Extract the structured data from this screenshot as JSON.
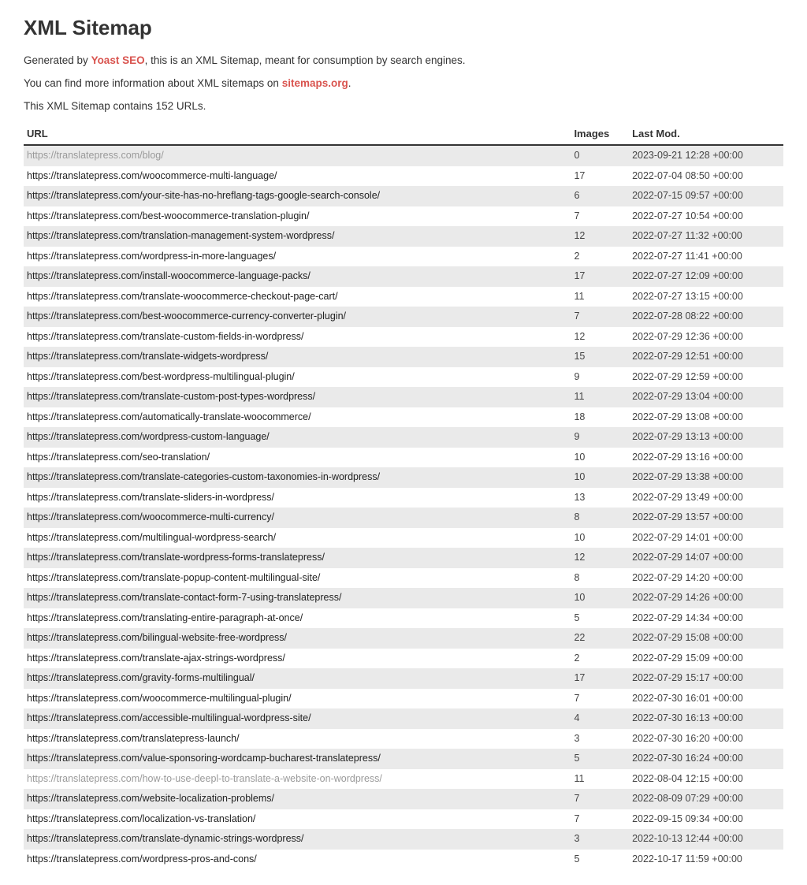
{
  "title": "XML Sitemap",
  "intro": {
    "generated_prefix": "Generated by ",
    "generated_link": "Yoast SEO",
    "generated_suffix": ", this is an XML Sitemap, meant for consumption by search engines.",
    "moreinfo_prefix": "You can find more information about XML sitemaps on ",
    "moreinfo_link": "sitemaps.org",
    "moreinfo_suffix": ".",
    "count_text": "This XML Sitemap contains 152 URLs."
  },
  "headers": {
    "url": "URL",
    "images": "Images",
    "lastmod": "Last Mod."
  },
  "rows": [
    {
      "url": "https://translatepress.com/blog/",
      "images": "0",
      "lastmod": "2023-09-21 12:28 +00:00",
      "muted": true
    },
    {
      "url": "https://translatepress.com/woocommerce-multi-language/",
      "images": "17",
      "lastmod": "2022-07-04 08:50 +00:00"
    },
    {
      "url": "https://translatepress.com/your-site-has-no-hreflang-tags-google-search-console/",
      "images": "6",
      "lastmod": "2022-07-15 09:57 +00:00"
    },
    {
      "url": "https://translatepress.com/best-woocommerce-translation-plugin/",
      "images": "7",
      "lastmod": "2022-07-27 10:54 +00:00"
    },
    {
      "url": "https://translatepress.com/translation-management-system-wordpress/",
      "images": "12",
      "lastmod": "2022-07-27 11:32 +00:00"
    },
    {
      "url": "https://translatepress.com/wordpress-in-more-languages/",
      "images": "2",
      "lastmod": "2022-07-27 11:41 +00:00"
    },
    {
      "url": "https://translatepress.com/install-woocommerce-language-packs/",
      "images": "17",
      "lastmod": "2022-07-27 12:09 +00:00"
    },
    {
      "url": "https://translatepress.com/translate-woocommerce-checkout-page-cart/",
      "images": "11",
      "lastmod": "2022-07-27 13:15 +00:00"
    },
    {
      "url": "https://translatepress.com/best-woocommerce-currency-converter-plugin/",
      "images": "7",
      "lastmod": "2022-07-28 08:22 +00:00"
    },
    {
      "url": "https://translatepress.com/translate-custom-fields-in-wordpress/",
      "images": "12",
      "lastmod": "2022-07-29 12:36 +00:00"
    },
    {
      "url": "https://translatepress.com/translate-widgets-wordpress/",
      "images": "15",
      "lastmod": "2022-07-29 12:51 +00:00"
    },
    {
      "url": "https://translatepress.com/best-wordpress-multilingual-plugin/",
      "images": "9",
      "lastmod": "2022-07-29 12:59 +00:00"
    },
    {
      "url": "https://translatepress.com/translate-custom-post-types-wordpress/",
      "images": "11",
      "lastmod": "2022-07-29 13:04 +00:00"
    },
    {
      "url": "https://translatepress.com/automatically-translate-woocommerce/",
      "images": "18",
      "lastmod": "2022-07-29 13:08 +00:00"
    },
    {
      "url": "https://translatepress.com/wordpress-custom-language/",
      "images": "9",
      "lastmod": "2022-07-29 13:13 +00:00"
    },
    {
      "url": "https://translatepress.com/seo-translation/",
      "images": "10",
      "lastmod": "2022-07-29 13:16 +00:00"
    },
    {
      "url": "https://translatepress.com/translate-categories-custom-taxonomies-in-wordpress/",
      "images": "10",
      "lastmod": "2022-07-29 13:38 +00:00"
    },
    {
      "url": "https://translatepress.com/translate-sliders-in-wordpress/",
      "images": "13",
      "lastmod": "2022-07-29 13:49 +00:00"
    },
    {
      "url": "https://translatepress.com/woocommerce-multi-currency/",
      "images": "8",
      "lastmod": "2022-07-29 13:57 +00:00"
    },
    {
      "url": "https://translatepress.com/multilingual-wordpress-search/",
      "images": "10",
      "lastmod": "2022-07-29 14:01 +00:00"
    },
    {
      "url": "https://translatepress.com/translate-wordpress-forms-translatepress/",
      "images": "12",
      "lastmod": "2022-07-29 14:07 +00:00"
    },
    {
      "url": "https://translatepress.com/translate-popup-content-multilingual-site/",
      "images": "8",
      "lastmod": "2022-07-29 14:20 +00:00"
    },
    {
      "url": "https://translatepress.com/translate-contact-form-7-using-translatepress/",
      "images": "10",
      "lastmod": "2022-07-29 14:26 +00:00"
    },
    {
      "url": "https://translatepress.com/translating-entire-paragraph-at-once/",
      "images": "5",
      "lastmod": "2022-07-29 14:34 +00:00"
    },
    {
      "url": "https://translatepress.com/bilingual-website-free-wordpress/",
      "images": "22",
      "lastmod": "2022-07-29 15:08 +00:00"
    },
    {
      "url": "https://translatepress.com/translate-ajax-strings-wordpress/",
      "images": "2",
      "lastmod": "2022-07-29 15:09 +00:00"
    },
    {
      "url": "https://translatepress.com/gravity-forms-multilingual/",
      "images": "17",
      "lastmod": "2022-07-29 15:17 +00:00"
    },
    {
      "url": "https://translatepress.com/woocommerce-multilingual-plugin/",
      "images": "7",
      "lastmod": "2022-07-30 16:01 +00:00"
    },
    {
      "url": "https://translatepress.com/accessible-multilingual-wordpress-site/",
      "images": "4",
      "lastmod": "2022-07-30 16:13 +00:00"
    },
    {
      "url": "https://translatepress.com/translatepress-launch/",
      "images": "3",
      "lastmod": "2022-07-30 16:20 +00:00"
    },
    {
      "url": "https://translatepress.com/value-sponsoring-wordcamp-bucharest-translatepress/",
      "images": "5",
      "lastmod": "2022-07-30 16:24 +00:00"
    },
    {
      "url": "https://translatepress.com/how-to-use-deepl-to-translate-a-website-on-wordpress/",
      "images": "11",
      "lastmod": "2022-08-04 12:15 +00:00",
      "muted": true
    },
    {
      "url": "https://translatepress.com/website-localization-problems/",
      "images": "7",
      "lastmod": "2022-08-09 07:29 +00:00"
    },
    {
      "url": "https://translatepress.com/localization-vs-translation/",
      "images": "7",
      "lastmod": "2022-09-15 09:34 +00:00"
    },
    {
      "url": "https://translatepress.com/translate-dynamic-strings-wordpress/",
      "images": "3",
      "lastmod": "2022-10-13 12:44 +00:00"
    },
    {
      "url": "https://translatepress.com/wordpress-pros-and-cons/",
      "images": "5",
      "lastmod": "2022-10-17 11:59 +00:00"
    }
  ]
}
